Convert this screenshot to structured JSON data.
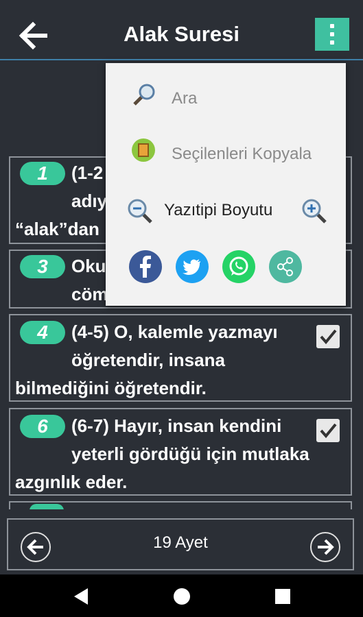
{
  "header": {
    "title": "Alak Suresi",
    "back_icon": "arrow-left-icon",
    "menu_icon": "more-vert-icon"
  },
  "verses": [
    {
      "number": "1",
      "lines": [
        "(1-2",
        "adıy",
        "“alak”dan"
      ],
      "checked": false
    },
    {
      "number": "3",
      "lines": [
        "Oku",
        "cöm"
      ],
      "checked": false
    },
    {
      "number": "4",
      "lines": [
        "(4-5) O, kalemle yazmayı",
        "öğretendir, insana",
        "bilmediğini öğretendir."
      ],
      "checked": true
    },
    {
      "number": "6",
      "lines": [
        "(6-7) Hayır, insan kendini",
        "yeterli gördüğü için mutlaka",
        "azgınlık eder."
      ],
      "checked": true
    }
  ],
  "footer": {
    "ayet_label": "19 Ayet"
  },
  "menu": {
    "search_label": "Ara",
    "copy_label": "Seçilenleri Kopyala",
    "font_size_label": "Yazıtipi Boyutu",
    "share": [
      "facebook-icon",
      "twitter-icon",
      "whatsapp-icon",
      "share-icon"
    ]
  },
  "colors": {
    "accent": "#3fc0a0",
    "badge": "#39c79a",
    "background": "#2b2f36",
    "facebook": "#3b5998",
    "twitter": "#1da1f2",
    "whatsapp": "#25d366"
  }
}
